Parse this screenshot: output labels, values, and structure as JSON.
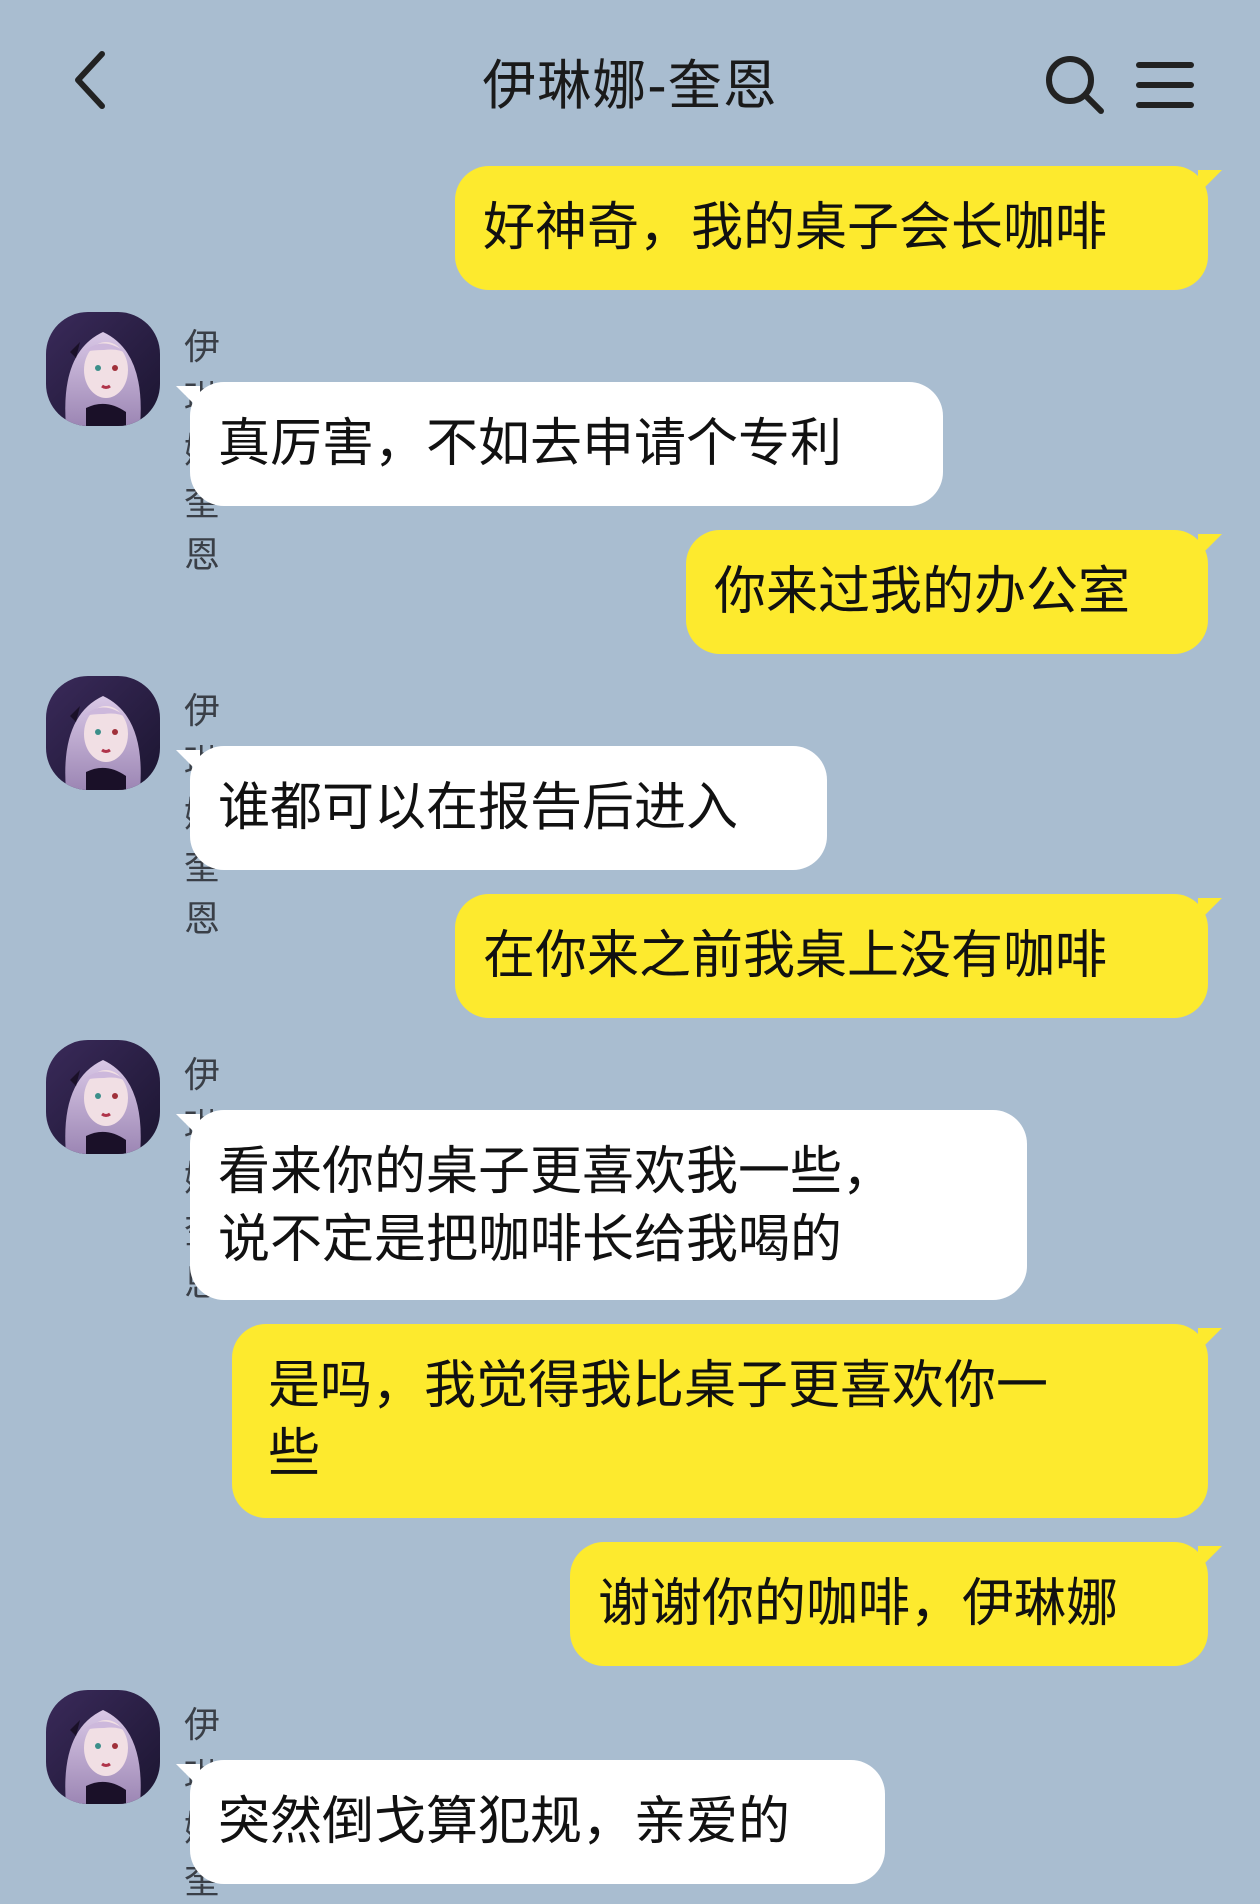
{
  "header": {
    "title": "伊琳娜-奎恩",
    "back_icon": "chevron-left-icon",
    "search_icon": "search-icon",
    "menu_icon": "menu-icon"
  },
  "colors": {
    "background": "#a9bdd0",
    "outgoing_bubble": "#fdea2e",
    "incoming_bubble": "#ffffff"
  },
  "messages": [
    {
      "direction": "out",
      "text": "好神奇，我的桌子会长咖啡"
    },
    {
      "direction": "in",
      "sender": "伊琳娜-奎恩",
      "text": "真厉害，不如去申请个专利"
    },
    {
      "direction": "out",
      "text": "你来过我的办公室"
    },
    {
      "direction": "in",
      "sender": "伊琳娜-奎恩",
      "text": "谁都可以在报告后进入"
    },
    {
      "direction": "out",
      "text": "在你来之前我桌上没有咖啡"
    },
    {
      "direction": "in",
      "sender": "伊琳娜-奎恩",
      "text": "看来你的桌子更喜欢我一些，\n说不定是把咖啡长给我喝的"
    },
    {
      "direction": "out",
      "text": "是吗，我觉得我比桌子更喜欢你一\n些"
    },
    {
      "direction": "out",
      "text": "谢谢你的咖啡，伊琳娜"
    },
    {
      "direction": "in",
      "sender": "伊琳娜-奎恩",
      "text": "突然倒戈算犯规，亲爱的"
    }
  ]
}
